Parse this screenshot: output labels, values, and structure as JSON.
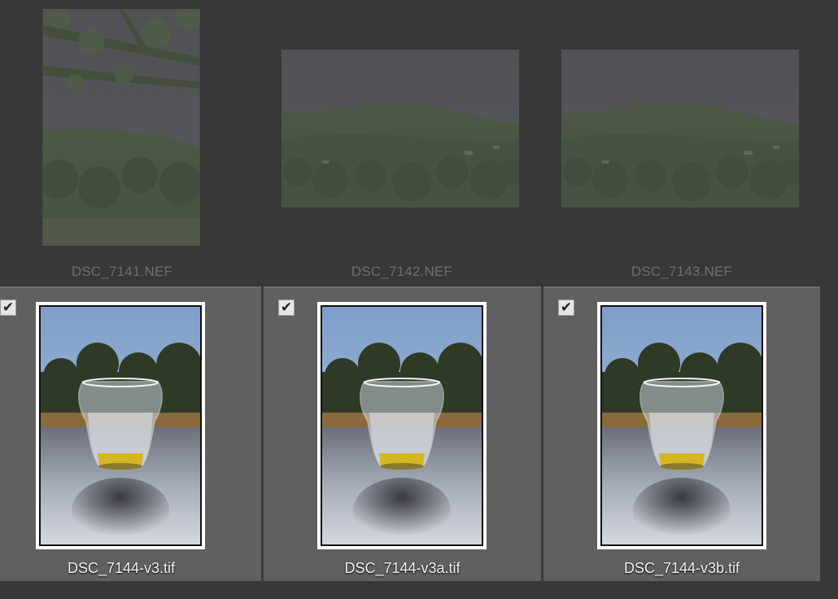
{
  "top_row": [
    {
      "filename": "DSC_7141.NEF",
      "orientation": "portrait"
    },
    {
      "filename": "DSC_7142.NEF",
      "orientation": "landscape"
    },
    {
      "filename": "DSC_7143.NEF",
      "orientation": "landscape"
    }
  ],
  "bottom_row": [
    {
      "filename": "DSC_7144-v3.tif",
      "checked": true,
      "check_glyph": "✔"
    },
    {
      "filename": "DSC_7144-v3a.tif",
      "checked": true,
      "check_glyph": "✔"
    },
    {
      "filename": "DSC_7144-v3b.tif",
      "checked": true,
      "check_glyph": "✔"
    }
  ],
  "colors": {
    "background": "#383838",
    "selected_cell": "#606060",
    "dim_label": "#6f6f6f",
    "bright_label": "#efefef"
  }
}
